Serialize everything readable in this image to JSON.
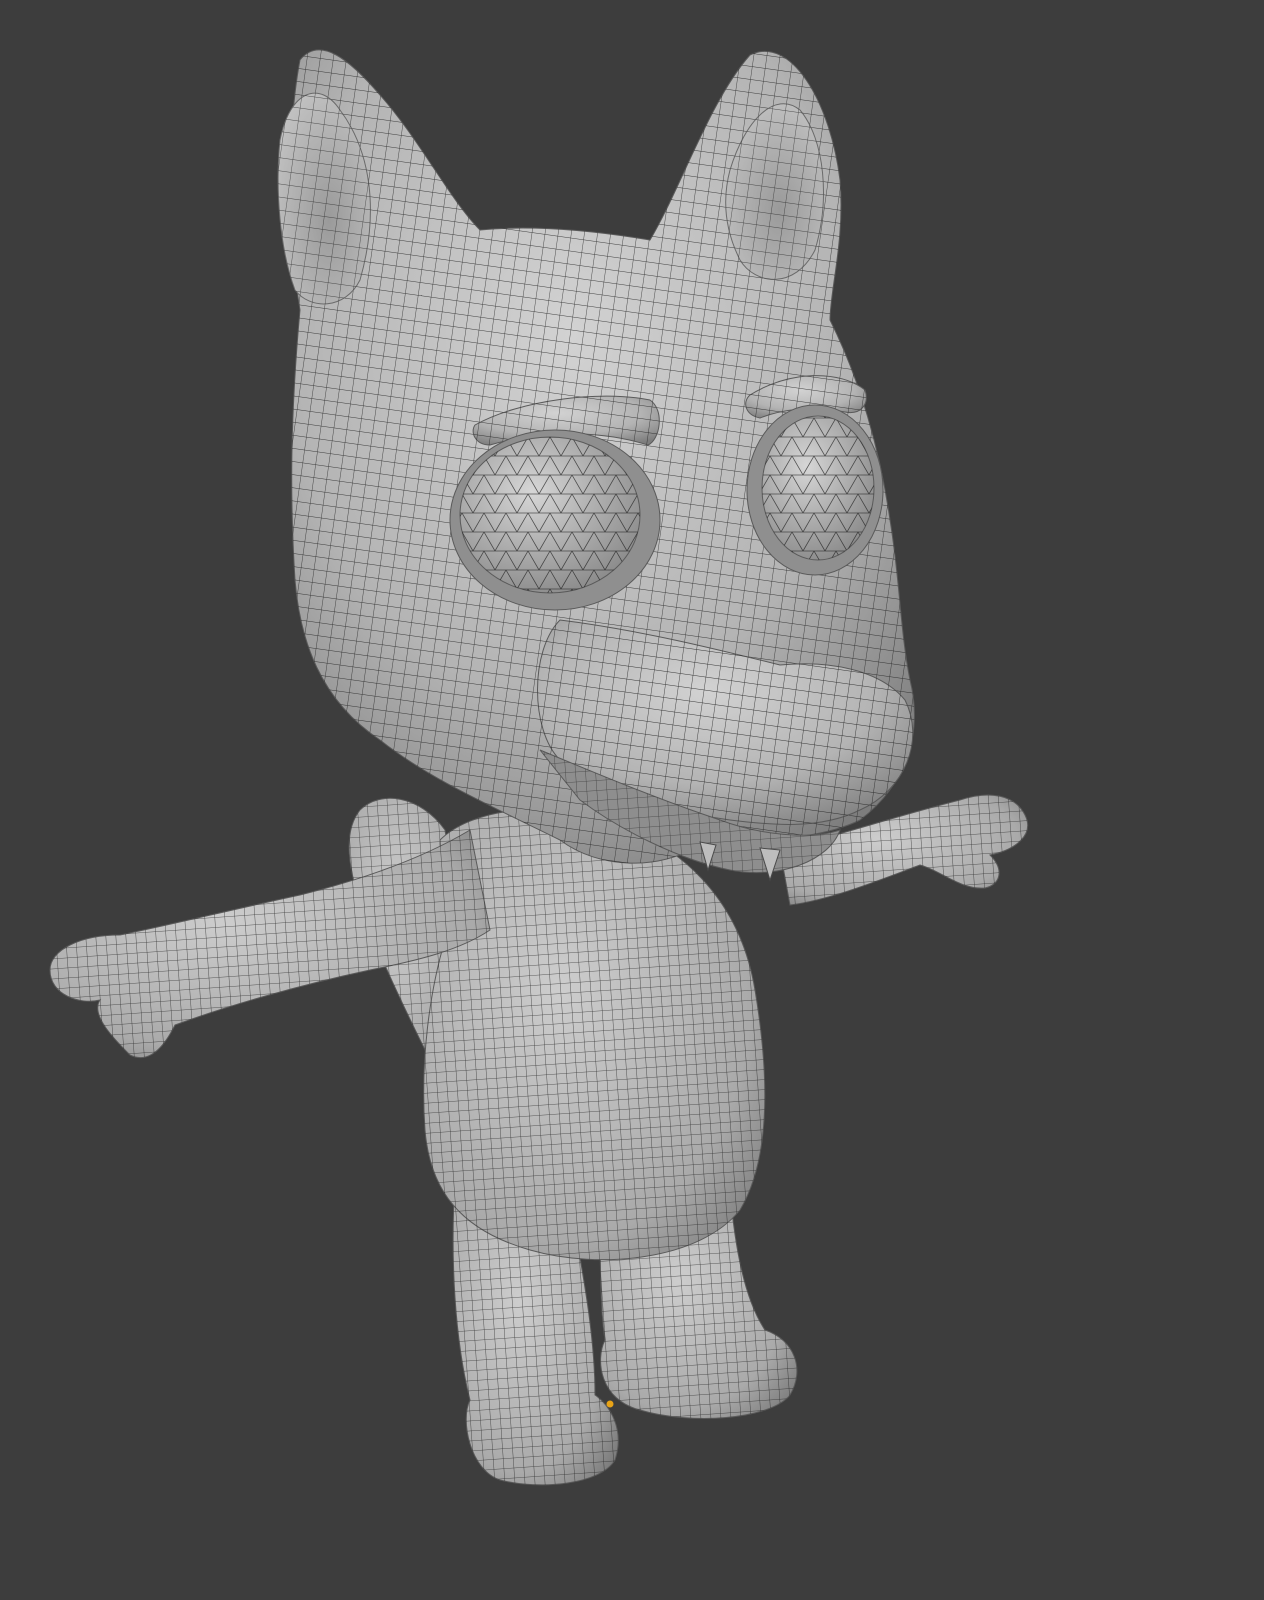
{
  "viewport": {
    "background": "#3d3d3d",
    "shading": "solid",
    "overlay": "wireframe",
    "object": "cartoon-wolf-character",
    "pose": "T-pose",
    "origin_color": "#e8a317"
  },
  "model": {
    "surface_light": "#c9c9c9",
    "surface_mid": "#a7a7a7",
    "surface_dark": "#6e6e6e",
    "wire_color": "#1e1e1e"
  }
}
